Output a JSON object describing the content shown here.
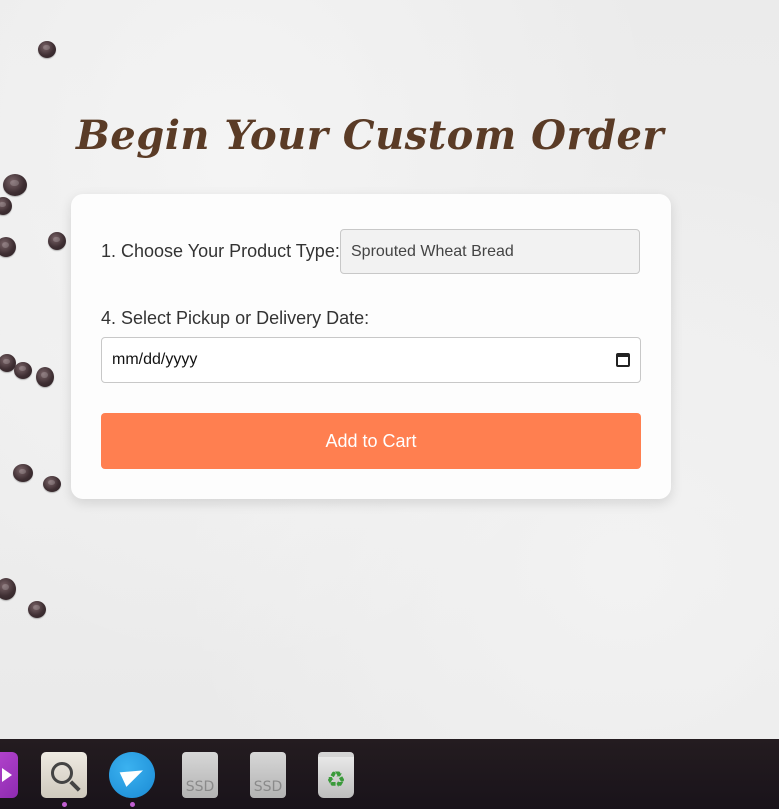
{
  "page": {
    "title": "Begin Your Custom Order"
  },
  "form": {
    "product_label": "1. Choose Your Product Type:",
    "product_value": "Sprouted Wheat Bread",
    "date_label": "4. Select Pickup or Delivery Date:",
    "date_placeholder": "mm/dd/yyyy",
    "submit_label": "Add to Cart"
  },
  "dock": {
    "items": [
      {
        "name": "media-player",
        "icon": "play-icon",
        "running": false
      },
      {
        "name": "image-viewer",
        "icon": "magnifier-icon",
        "running": true
      },
      {
        "name": "telegram",
        "icon": "paper-plane-icon",
        "running": true
      },
      {
        "name": "drive-1",
        "icon": "ssd-drive-icon",
        "label": "SSD"
      },
      {
        "name": "drive-2",
        "icon": "ssd-drive-icon",
        "label": "SSD"
      },
      {
        "name": "trash",
        "icon": "recycle-icon"
      }
    ]
  },
  "colors": {
    "accent_button": "#ff7f50",
    "title_brown": "#5a3b26",
    "dock_background": "#1d171a",
    "running_indicator": "#c05fd0"
  }
}
